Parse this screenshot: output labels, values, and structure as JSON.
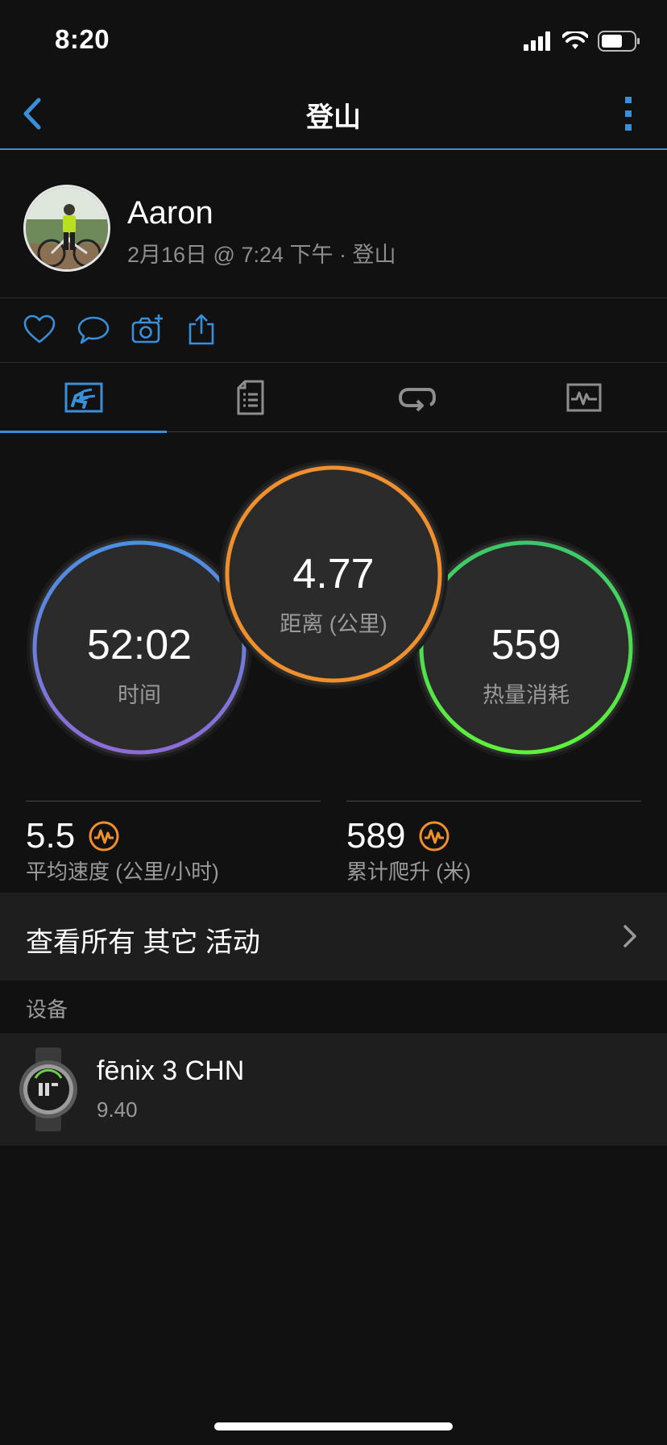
{
  "status_bar": {
    "time": "8:20",
    "icons": [
      "signal-icon",
      "wifi-icon",
      "battery-icon"
    ]
  },
  "header": {
    "title": "登山",
    "back_icon": "chevron-left-icon",
    "more_icon": "more-vertical-icon"
  },
  "profile": {
    "name": "Aaron",
    "meta": "2月16日 @ 7:24 下午 · 登山"
  },
  "actions": [
    {
      "icon": "heart-icon"
    },
    {
      "icon": "comment-icon"
    },
    {
      "icon": "add-photo-icon"
    },
    {
      "icon": "share-icon"
    }
  ],
  "tabs": [
    {
      "icon": "overview-icon",
      "active": true
    },
    {
      "icon": "details-icon",
      "active": false
    },
    {
      "icon": "laps-icon",
      "active": false
    },
    {
      "icon": "charts-icon",
      "active": false
    }
  ],
  "stats": {
    "time": {
      "value": "52:02",
      "label": "时间"
    },
    "distance": {
      "value": "4.77",
      "label": "距离 (公里)"
    },
    "calories": {
      "value": "559",
      "label": "热量消耗"
    }
  },
  "metrics": [
    {
      "value": "5.5",
      "label": "平均速度 (公里/小时)"
    },
    {
      "value": "589",
      "label": "累计爬升 (米)"
    }
  ],
  "view_all": {
    "label": "查看所有 其它 活动"
  },
  "devices_section": {
    "title": "设备"
  },
  "device": {
    "name": "fēnix 3 CHN",
    "version": "9.40"
  },
  "colors": {
    "accent": "#3a8fd9",
    "background": "#111111",
    "row_background": "#1e1e1e",
    "time_ring_start": "#4a90e2",
    "time_ring_end": "#8e6bd6",
    "distance_ring": "#f0902c",
    "calories_ring_start": "#3cc76a",
    "calories_ring_end": "#5ef23a",
    "badge": "#f0902c"
  }
}
